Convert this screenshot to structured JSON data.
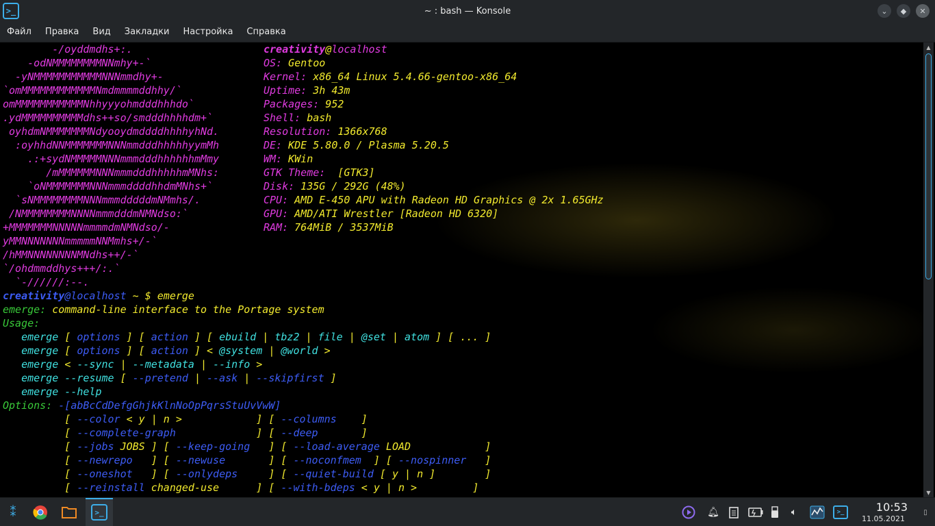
{
  "window": {
    "title": "~ : bash — Konsole",
    "icon": "konsole-icon",
    "controls": {
      "minimize": "⌄",
      "maximize": "◆",
      "close": "✕"
    }
  },
  "menu": [
    "Файл",
    "Правка",
    "Вид",
    "Закладки",
    "Настройка",
    "Справка"
  ],
  "terminal": {
    "logo": [
      "        -/oyddmdhs+:.",
      "    -odNMMMMMMMMNNmhy+-`",
      "  -yNMMMMMMMMMMMNNNmmdhy+-",
      "`omMMMMMMMMMMMMNmdmmmmddhhy/`",
      "omMMMMMMMMMMMNhhyyyohmdddhhhdo`",
      ".ydMMMMMMMMMMdhs++so/smdddhhhhdm+`",
      " oyhdmNMMMMMMMNdyooydmddddhhhhyhNd.",
      "  :oyhhdNNMMMMMMMNNNmmdddhhhhhyymMh",
      "    .:+sydNMMMMMNNNmmmdddhhhhhhmMmy",
      "       /mMMMMMMNNNmmmdddhhhhhmMNhs:",
      "    `oNMMMMMMMNNNmmmddddhhdmMNhs+`",
      "  `sNMMMMMMMMNNNmmmdddddmNMmhs/.",
      " /NMMMMMMMMNNNNmmmdddmNMNdso:`",
      "+MMMMMMMNNNNNmmmmdmNMNdso/-",
      "yMMNNNNNNNmmmmmNNMmhs+/-`",
      "/hMMNNNNNNNNMNdhs++/-`",
      "`/ohdmmddhys+++/:.`",
      "  `-//////:--."
    ],
    "info": {
      "user": "creativity",
      "at": "@",
      "host": "localhost",
      "rows": [
        {
          "key": "OS:",
          "value": " Gentoo"
        },
        {
          "key": "Kernel:",
          "value": " x86_64 Linux 5.4.66-gentoo-x86_64"
        },
        {
          "key": "Uptime:",
          "value": " 3h 43m"
        },
        {
          "key": "Packages:",
          "value": " 952"
        },
        {
          "key": "Shell:",
          "value": " bash"
        },
        {
          "key": "Resolution:",
          "value": " 1366x768"
        },
        {
          "key": "DE:",
          "value": " KDE 5.80.0 / Plasma 5.20.5"
        },
        {
          "key": "WM:",
          "value": " KWin"
        },
        {
          "key": "GTK Theme:",
          "value": "  [GTK3]"
        },
        {
          "key": "Disk:",
          "value": " 135G / 292G (48%)"
        },
        {
          "key": "CPU:",
          "value": " AMD E-450 APU with Radeon HD Graphics @ 2x 1.65GHz"
        },
        {
          "key": "GPU:",
          "value": " AMD/ATI Wrestler [Radeon HD 6320]"
        },
        {
          "key": "RAM:",
          "value": " 764MiB / 3537MiB"
        }
      ]
    },
    "prompt": {
      "user": "creativity",
      "host": "@localhost",
      "path": " ~ $ ",
      "command": "emerge"
    },
    "emerge": {
      "name": "emerge:",
      "description": " command-line interface to the Portage system",
      "usage_label": "Usage:",
      "options_label": "Options:",
      "flags": "-[abBcCdDefgGhjkKlnNoOpPqrsStuUvVwW]"
    }
  },
  "taskbar": {
    "launcher": "application-launcher-icon",
    "apps": [
      "chrome-icon",
      "folder-icon",
      "konsole-icon"
    ],
    "tray": [
      "media-player-icon",
      "notifications-icon",
      "clipboard-icon",
      "battery-icon",
      "usb-icon",
      "volume-icon",
      "system-monitor-icon",
      "konsole-icon"
    ],
    "time": "10:53",
    "date": "11.05.2021"
  },
  "colors": {
    "yellow": "#f2ea2e",
    "magenta": "#e03be0",
    "blue": "#3d5cf5",
    "green": "#39c939",
    "cyan": "#40e0e0",
    "accent": "#3daee9"
  }
}
